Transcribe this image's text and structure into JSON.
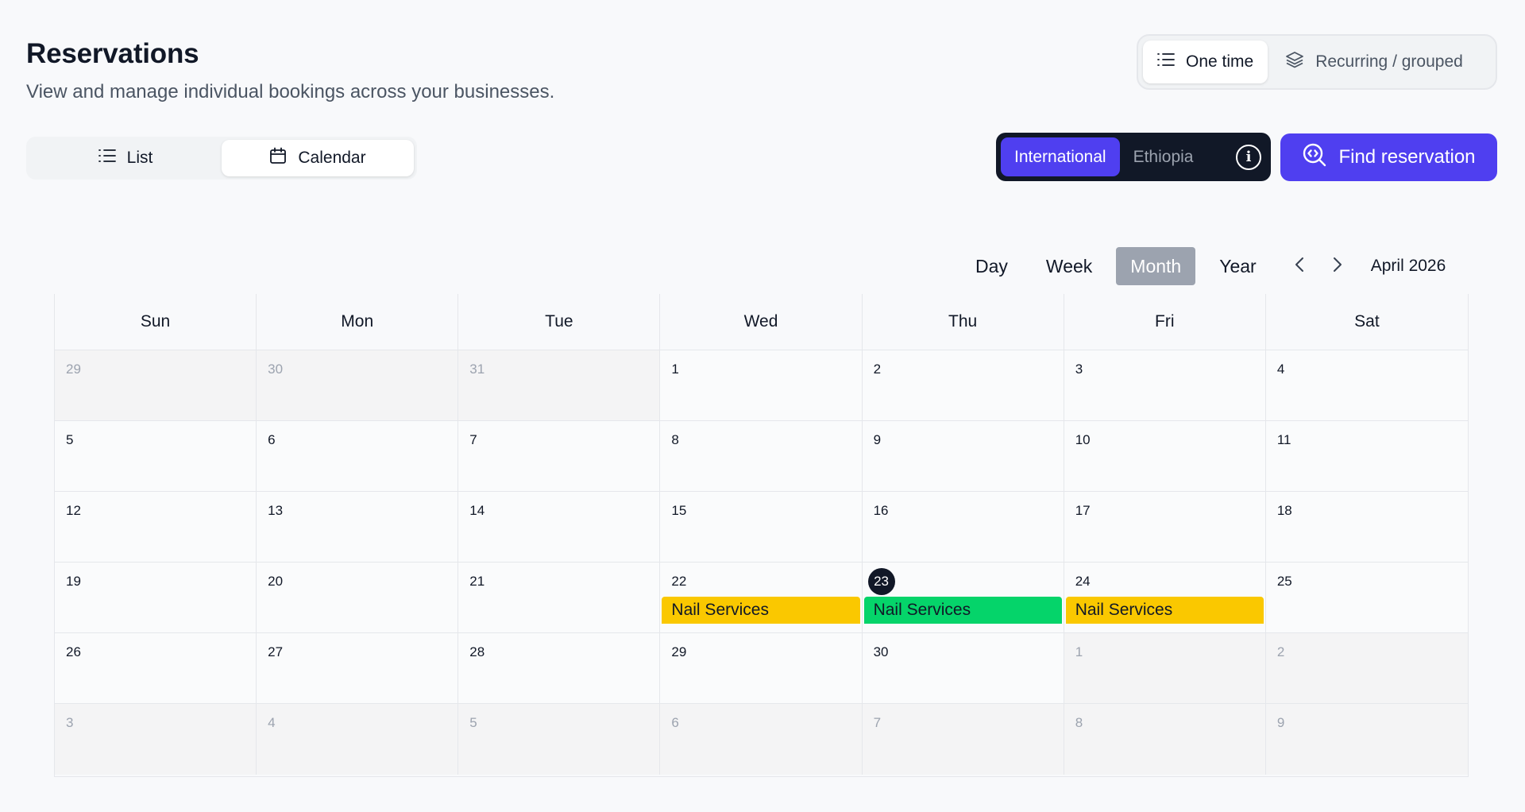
{
  "header": {
    "title": "Reservations",
    "subtitle": "View and manage individual bookings across your businesses."
  },
  "booking_type": {
    "options": [
      {
        "label": "One time",
        "icon": "list-icon",
        "active": true
      },
      {
        "label": "Recurring / grouped",
        "icon": "layers-icon",
        "active": false
      }
    ]
  },
  "view_switch": {
    "options": [
      {
        "label": "List",
        "icon": "list-icon",
        "active": false
      },
      {
        "label": "Calendar",
        "icon": "calendar-icon",
        "active": true
      }
    ]
  },
  "region": {
    "options": [
      {
        "label": "International",
        "active": true
      },
      {
        "label": "Ethiopia",
        "active": false
      }
    ],
    "info_icon": "info-icon"
  },
  "find_button": {
    "label": "Find reservation",
    "icon": "search-icon"
  },
  "colors": {
    "primary": "#4f3ff0",
    "dark": "#111827",
    "event_yellow": "#fac800",
    "event_green": "#05d46a"
  },
  "calendar": {
    "views": [
      "Day",
      "Week",
      "Month",
      "Year"
    ],
    "active_view": "Month",
    "month_label": "April 2026",
    "weekdays": [
      "Sun",
      "Mon",
      "Tue",
      "Wed",
      "Thu",
      "Fri",
      "Sat"
    ],
    "days": [
      {
        "d": "29",
        "other": true
      },
      {
        "d": "30",
        "other": true
      },
      {
        "d": "31",
        "other": true
      },
      {
        "d": "1"
      },
      {
        "d": "2"
      },
      {
        "d": "3"
      },
      {
        "d": "4"
      },
      {
        "d": "5"
      },
      {
        "d": "6"
      },
      {
        "d": "7"
      },
      {
        "d": "8"
      },
      {
        "d": "9"
      },
      {
        "d": "10"
      },
      {
        "d": "11"
      },
      {
        "d": "12"
      },
      {
        "d": "13"
      },
      {
        "d": "14"
      },
      {
        "d": "15"
      },
      {
        "d": "16"
      },
      {
        "d": "17"
      },
      {
        "d": "18"
      },
      {
        "d": "19"
      },
      {
        "d": "20"
      },
      {
        "d": "21"
      },
      {
        "d": "22",
        "event": {
          "label": "Nail Services",
          "color": "#fac800"
        }
      },
      {
        "d": "23",
        "today": true,
        "event": {
          "label": "Nail Services",
          "color": "#05d46a"
        }
      },
      {
        "d": "24",
        "event": {
          "label": "Nail Services",
          "color": "#fac800"
        }
      },
      {
        "d": "25"
      },
      {
        "d": "26"
      },
      {
        "d": "27"
      },
      {
        "d": "28"
      },
      {
        "d": "29"
      },
      {
        "d": "30"
      },
      {
        "d": "1",
        "other": true
      },
      {
        "d": "2",
        "other": true
      },
      {
        "d": "3",
        "other": true
      },
      {
        "d": "4",
        "other": true
      },
      {
        "d": "5",
        "other": true
      },
      {
        "d": "6",
        "other": true
      },
      {
        "d": "7",
        "other": true
      },
      {
        "d": "8",
        "other": true
      },
      {
        "d": "9",
        "other": true
      }
    ]
  }
}
